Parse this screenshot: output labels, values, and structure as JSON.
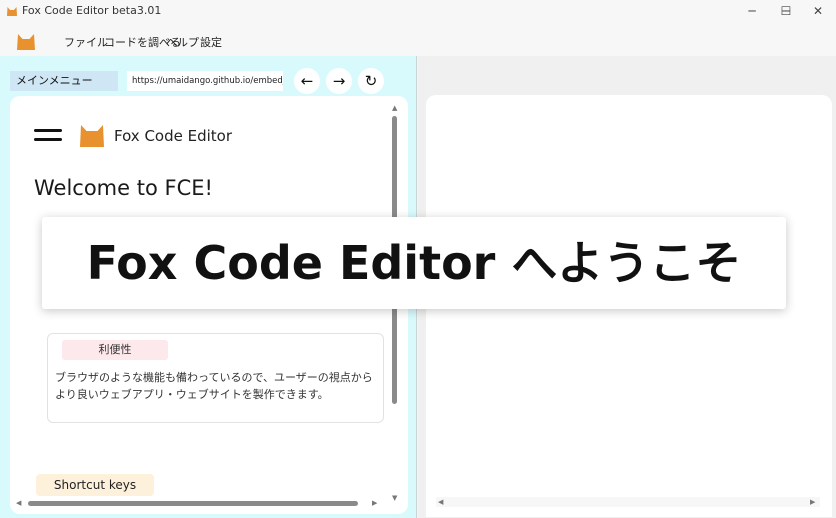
{
  "window": {
    "title": "Fox Code Editor beta3.01",
    "controls": {
      "minimize": "─",
      "maximize": "☐",
      "close": "✕"
    }
  },
  "menubar": {
    "items": [
      "ファイル",
      "コードを調べる",
      "ヘルプ",
      "設定"
    ]
  },
  "browser_toolbar": {
    "tab_label": "メインメニュー",
    "url": "https://umaidango.github.io/embed_fc",
    "nav_back": "←",
    "nav_forward": "→",
    "nav_reload": "↻"
  },
  "left_page": {
    "brand": "Fox Code Editor",
    "welcome": "Welcome to FCE!",
    "card": {
      "tag": "利便性",
      "body": "ブラウザのような機能も備わっているので、ユーザーの視点からより良いウェブアプリ・ウェブサイトを製作できます。"
    },
    "shortcut_label": "Shortcut keys"
  },
  "overlay": {
    "text": "Fox Code Editor へようこそ"
  },
  "colors": {
    "accent_orange": "#e8912f",
    "left_pane_bg": "#d9fafd",
    "tab_bg": "#cfe6f5",
    "card_tag_bg": "#fde8ec",
    "shortcut_bg": "#fdf1dc"
  }
}
